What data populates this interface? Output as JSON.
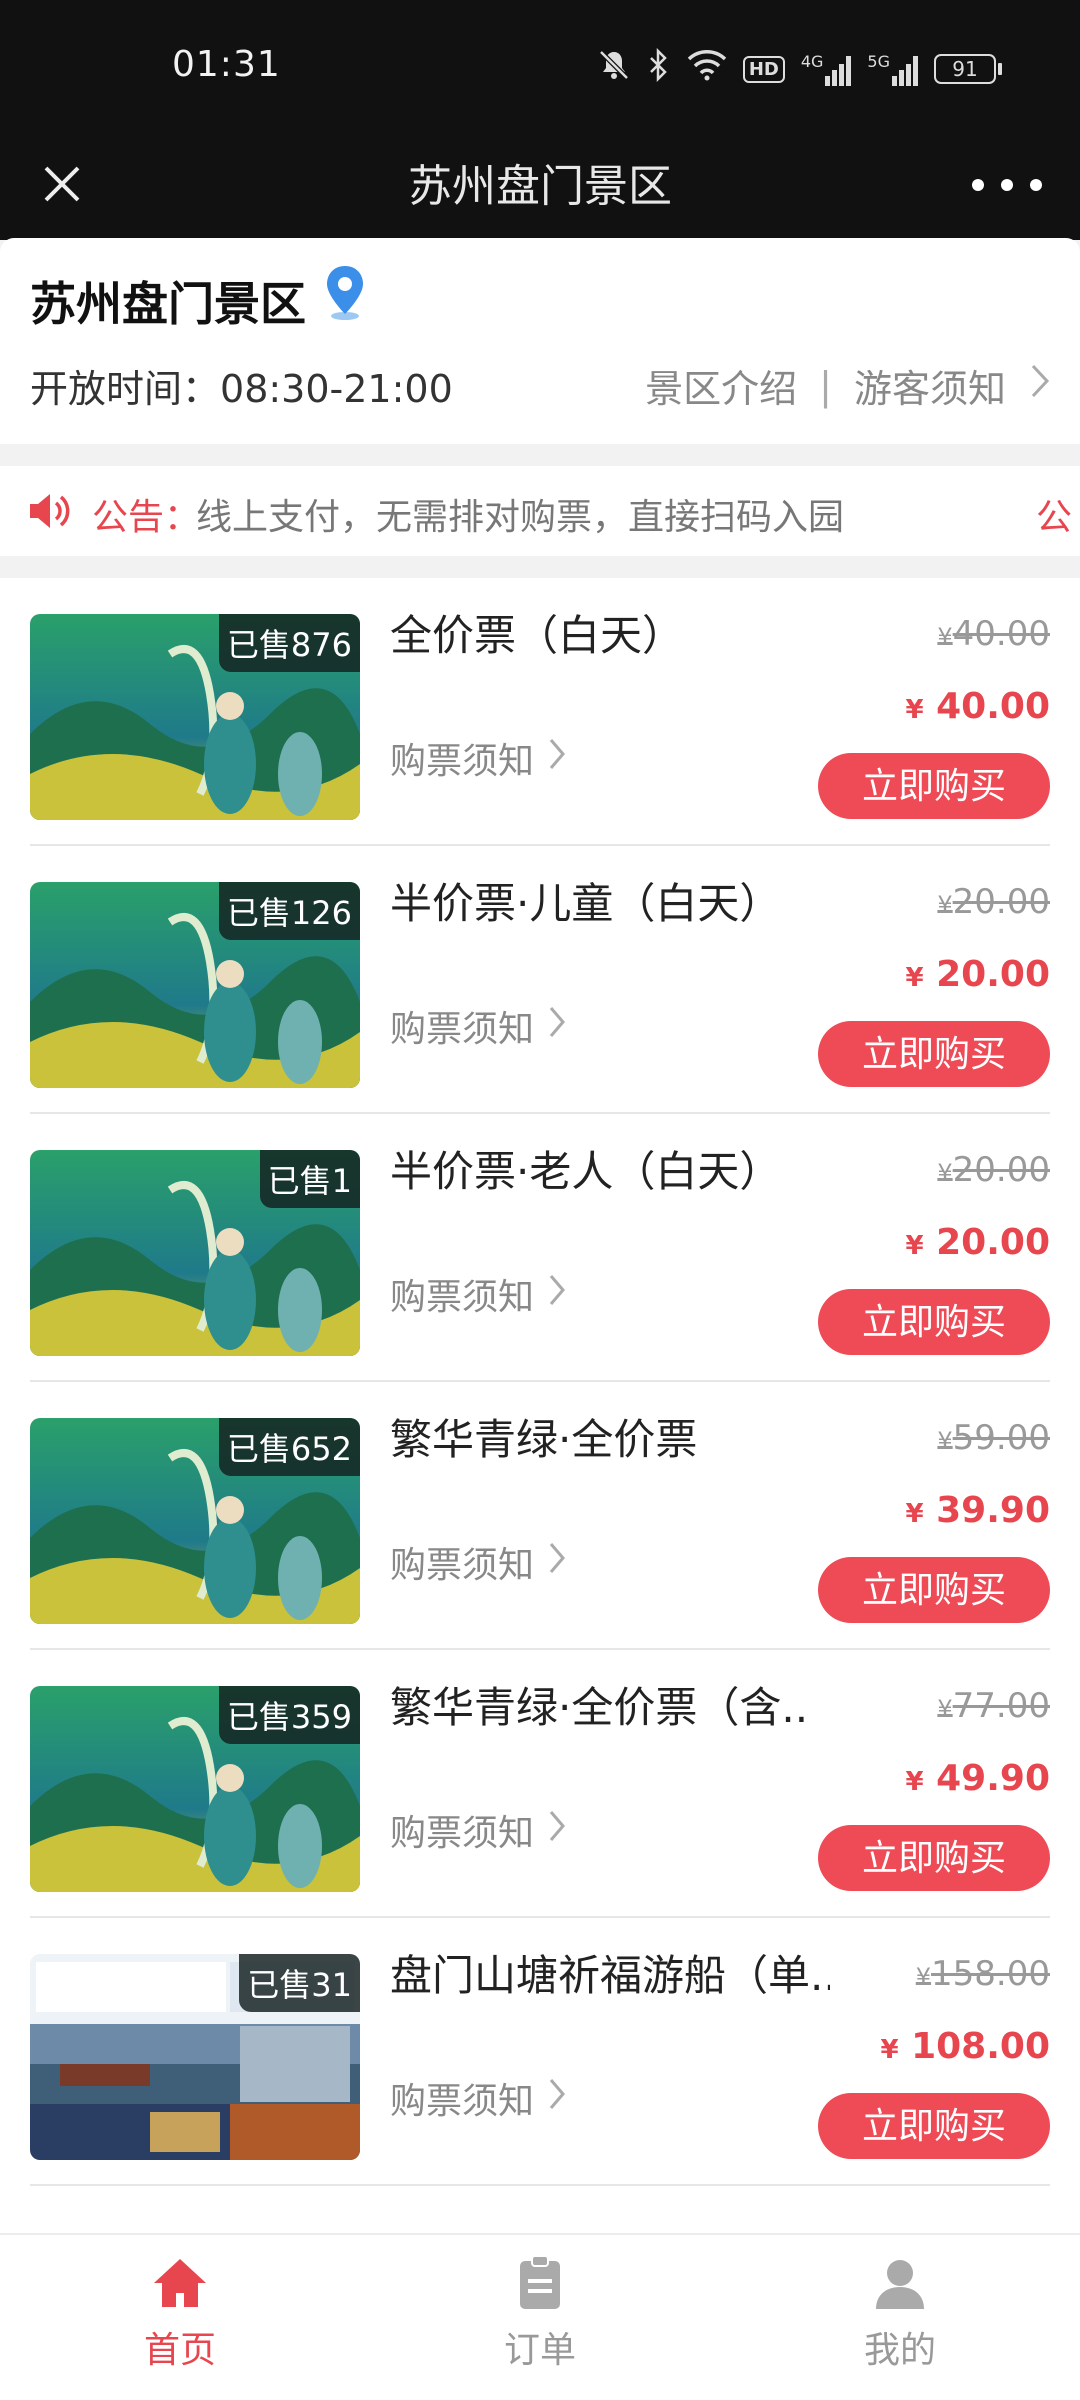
{
  "status_bar": {
    "time": "01:31",
    "hd_badge": "HD",
    "network_4g": "4G",
    "network_5g": "5G",
    "battery": "91",
    "icons": [
      "mute-icon",
      "bluetooth-icon",
      "wifi-icon",
      "hd-icon",
      "signal-4g-icon",
      "signal-5g-icon",
      "battery-icon"
    ]
  },
  "titlebar": {
    "title": "苏州盘门景区",
    "close_icon": "close-icon",
    "more_icon": "more-icon"
  },
  "header": {
    "name": "苏州盘门景区",
    "hours_label": "开放时间：",
    "hours_value": "08:30-21:00",
    "intro_link": "景区介绍",
    "separator": "|",
    "visitor_link": "游客须知",
    "pin_color": "#3b8fe8"
  },
  "notice": {
    "label": "公告：",
    "label_visible": "公告：",
    "text": "线上支付，无需排对购票，直接扫码入园",
    "next_fragment": "公"
  },
  "tickets": [
    {
      "name": "全价票（白天）",
      "sold": "已售876",
      "original_price": "40.00",
      "price": "40.00",
      "notice": "购票须知",
      "buy": "立即购买",
      "image": "繁华青绿"
    },
    {
      "name": "半价票·儿童（白天）",
      "sold": "已售126",
      "original_price": "20.00",
      "price": "20.00",
      "notice": "购票须知",
      "buy": "立即购买",
      "image": "繁华青绿"
    },
    {
      "name": "半价票·老人（白天）",
      "sold": "已售1",
      "original_price": "20.00",
      "price": "20.00",
      "notice": "购票须知",
      "buy": "立即购买",
      "image": "繁华青绿"
    },
    {
      "name": "繁华青绿·全价票",
      "sold": "已售652",
      "original_price": "59.00",
      "price": "39.90",
      "notice": "购票须知",
      "buy": "立即购买",
      "image": "繁华青绿"
    },
    {
      "name": "繁华青绿·全价票（含..",
      "sold": "已售359",
      "original_price": "77.00",
      "price": "49.90",
      "notice": "购票须知",
      "buy": "立即购买",
      "image": "繁华青绿"
    },
    {
      "name": "盘门山塘祈福游船（单..",
      "sold": "已售31",
      "original_price": "158.00",
      "price": "108.00",
      "notice": "购票须知",
      "buy": "立即购买",
      "image": "盘门·山塘白居易码头 祈福线 108/人"
    }
  ],
  "currency": "¥",
  "bottom_nav": [
    {
      "label": "首页",
      "icon": "home-icon",
      "active": true
    },
    {
      "label": "订单",
      "icon": "clipboard-icon",
      "active": false
    },
    {
      "label": "我的",
      "icon": "user-icon",
      "active": false
    }
  ],
  "colors": {
    "accent": "#ee4b56",
    "price_red": "#e8464f",
    "topbar_bg": "#111111"
  }
}
